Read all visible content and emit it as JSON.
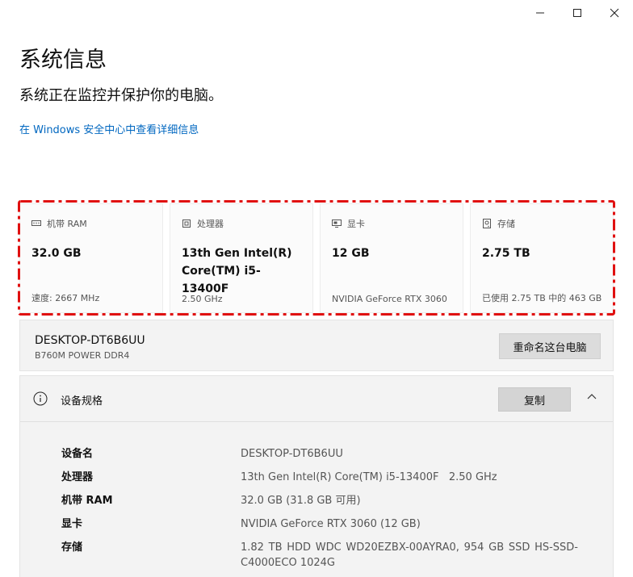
{
  "window": {
    "minimize_icon": "minimize-icon",
    "maximize_icon": "maximize-icon",
    "close_icon": "close-icon"
  },
  "header": {
    "title": "系统信息",
    "subtitle": "系统正在监控并保护你的电脑。",
    "link": "在 Windows 安全中心中查看详细信息"
  },
  "cards": [
    {
      "icon": "memory-icon",
      "label": "机带 RAM",
      "value": "32.0 GB",
      "foot": "速度: 2667 MHz"
    },
    {
      "icon": "cpu-icon",
      "label": "处理器",
      "value": "13th Gen Intel(R) Core(TM) i5-13400F",
      "foot": "2.50 GHz"
    },
    {
      "icon": "display-icon",
      "label": "显卡",
      "value": "12 GB",
      "foot": "NVIDIA GeForce RTX 3060"
    },
    {
      "icon": "storage-icon",
      "label": "存储",
      "value": "2.75 TB",
      "foot": "已使用 2.75 TB 中的 463 GB"
    }
  ],
  "pc": {
    "name": "DESKTOP-DT6B6UU",
    "model": "B760M POWER DDR4",
    "rename_label": "重命名这台电脑"
  },
  "specs": {
    "title": "设备规格",
    "copy_label": "复制",
    "rows": [
      {
        "key": "设备名",
        "value": "DESKTOP-DT6B6UU"
      },
      {
        "key": "处理器",
        "value": "13th Gen Intel(R) Core(TM) i5-13400F   2.50 GHz"
      },
      {
        "key": "机带 RAM",
        "value": "32.0 GB (31.8 GB 可用)"
      },
      {
        "key": "显卡",
        "value": "NVIDIA GeForce RTX 3060 (12 GB)"
      },
      {
        "key": "存储",
        "value": "1.82 TB HDD WDC WD20EZBX-00AYRA0, 954 GB SSD HS-SSD-C4000ECO 1024G"
      }
    ]
  },
  "colors": {
    "accent_link": "#0067c0",
    "highlight": "#e01010"
  }
}
